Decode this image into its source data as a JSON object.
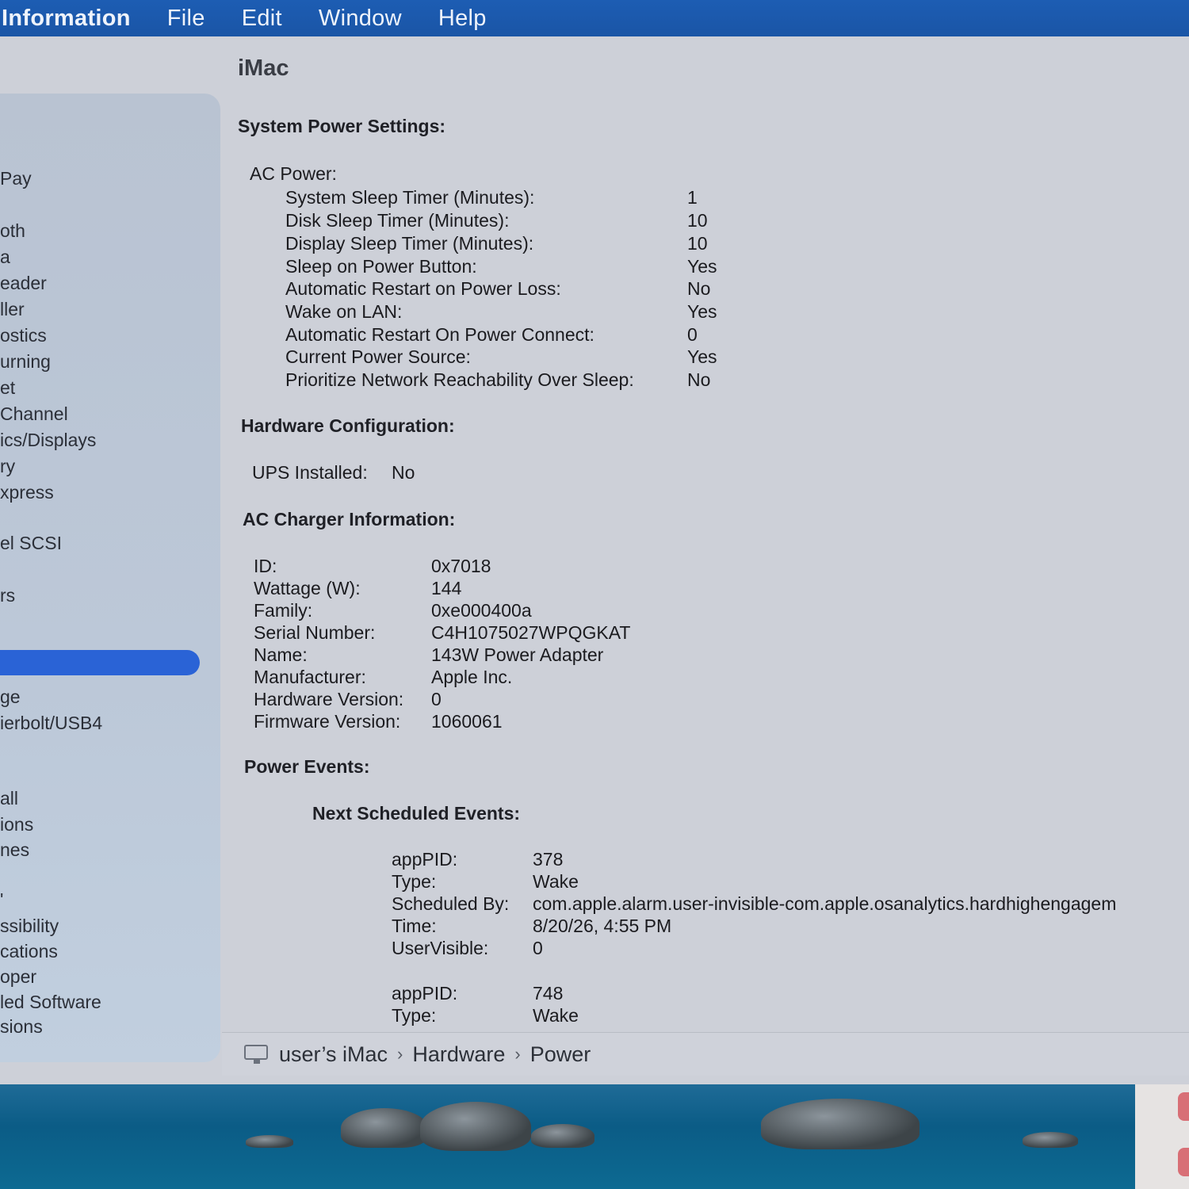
{
  "menubar": {
    "app": "Information",
    "items": [
      "File",
      "Edit",
      "Window",
      "Help"
    ]
  },
  "sidebar": {
    "items": [
      "Pay",
      "oth",
      "a",
      "eader",
      "ller",
      "ostics",
      "urning",
      "et",
      "Channel",
      "ics/Displays",
      "ry",
      "xpress",
      "el SCSI",
      "",
      "rs",
      "ge",
      "ierbolt/USB4",
      "all",
      "ions",
      "nes",
      "'",
      "ssibility",
      "cations",
      "oper",
      "led Software",
      "sions"
    ]
  },
  "content": {
    "title": "iMac",
    "system_power_settings": {
      "heading": "System Power Settings:",
      "ac_power_label": "AC Power:",
      "rows": [
        {
          "key": "System Sleep Timer (Minutes):",
          "value": "1"
        },
        {
          "key": "Disk Sleep Timer (Minutes):",
          "value": "10"
        },
        {
          "key": "Display Sleep Timer (Minutes):",
          "value": "10"
        },
        {
          "key": "Sleep on Power Button:",
          "value": "Yes"
        },
        {
          "key": "Automatic Restart on Power Loss:",
          "value": "No"
        },
        {
          "key": "Wake on LAN:",
          "value": "Yes"
        },
        {
          "key": "Automatic Restart On Power Connect:",
          "value": "0"
        },
        {
          "key": "Current Power Source:",
          "value": "Yes"
        },
        {
          "key": "Prioritize Network Reachability Over Sleep:",
          "value": "No"
        }
      ]
    },
    "hardware_configuration": {
      "heading": "Hardware Configuration:",
      "ups_key": "UPS Installed:",
      "ups_value": "No"
    },
    "ac_charger": {
      "heading": "AC Charger Information:",
      "rows": [
        {
          "key": "ID:",
          "value": "0x7018"
        },
        {
          "key": "Wattage (W):",
          "value": "144"
        },
        {
          "key": "Family:",
          "value": "0xe000400a"
        },
        {
          "key": "Serial Number:",
          "value": "C4H1075027WPQGKAT"
        },
        {
          "key": "Name:",
          "value": "143W Power Adapter"
        },
        {
          "key": "Manufacturer:",
          "value": "Apple Inc."
        },
        {
          "key": "Hardware Version:",
          "value": "0"
        },
        {
          "key": "Firmware Version:",
          "value": "1060061"
        }
      ]
    },
    "power_events": {
      "heading": "Power Events:",
      "next_heading": "Next Scheduled Events:",
      "event1": [
        {
          "key": "appPID:",
          "value": "378"
        },
        {
          "key": "Type:",
          "value": "Wake"
        },
        {
          "key": "Scheduled By:",
          "value": "com.apple.alarm.user-invisible-com.apple.osanalytics.hardhighengagem"
        },
        {
          "key": "Time:",
          "value": "8/20/26, 4:55 PM"
        },
        {
          "key": "UserVisible:",
          "value": "0"
        }
      ],
      "event2": [
        {
          "key": "appPID:",
          "value": "748"
        },
        {
          "key": "Type:",
          "value": "Wake"
        }
      ]
    }
  },
  "pathbar": {
    "icon": "imac-icon",
    "crumbs": [
      "user’s iMac",
      "Hardware",
      "Power"
    ],
    "separator": "›"
  },
  "colors": {
    "menubar": "#1d5db3",
    "selection": "#2a63d6",
    "window_bg": "#cdd0d8",
    "sidebar_bg": "#bcc8d8"
  }
}
